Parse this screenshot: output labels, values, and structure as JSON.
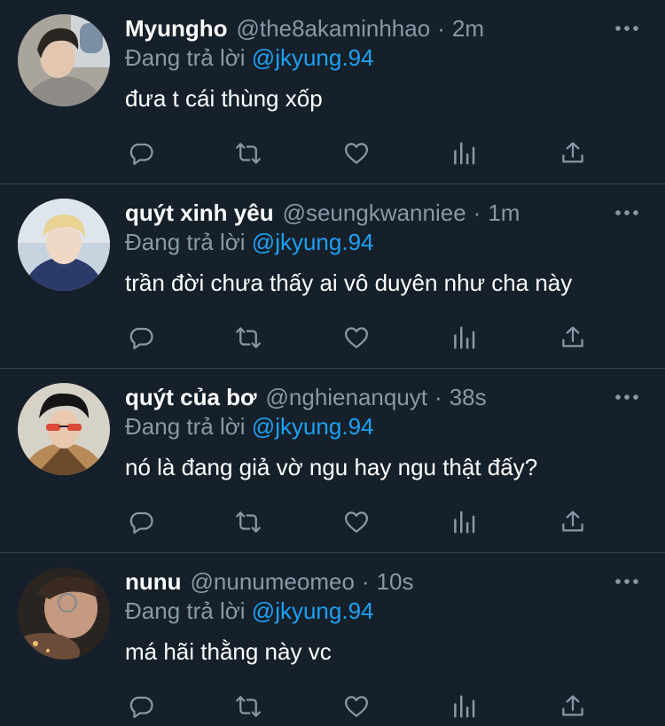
{
  "colors": {
    "background": "#15202b",
    "muted": "#8899a6",
    "accent": "#1da1f2",
    "divider": "#38444d"
  },
  "tweets": [
    {
      "name": "Myungho",
      "handle": "@the8akaminhhao",
      "separator": "·",
      "time": "2m",
      "reply_prefix": "Đang trả lời",
      "reply_to": "@jkyung.94",
      "text": "đưa t cái thùng xốp"
    },
    {
      "name": "quýt xinh yêu",
      "handle": "@seungkwanniee",
      "separator": "·",
      "time": "1m",
      "reply_prefix": "Đang trả lời",
      "reply_to": "@jkyung.94",
      "text": "trần đời chưa thấy ai vô duyên như cha này"
    },
    {
      "name": "quýt của bơ",
      "handle": "@nghienanquyt",
      "separator": "·",
      "time": "38s",
      "reply_prefix": "Đang trả lời",
      "reply_to": "@jkyung.94",
      "text": "nó là đang giả vờ ngu hay ngu thật đấy?"
    },
    {
      "name": "nunu",
      "handle": "@nunumeomeo",
      "separator": "·",
      "time": "10s",
      "reply_prefix": "Đang trả lời",
      "reply_to": "@jkyung.94",
      "text": "má hãi thằng này vc"
    }
  ],
  "icons": {
    "more": "more-horizontal-icon",
    "reply": "reply-icon",
    "retweet": "retweet-icon",
    "like": "heart-icon",
    "stats": "analytics-icon",
    "share": "share-icon"
  }
}
